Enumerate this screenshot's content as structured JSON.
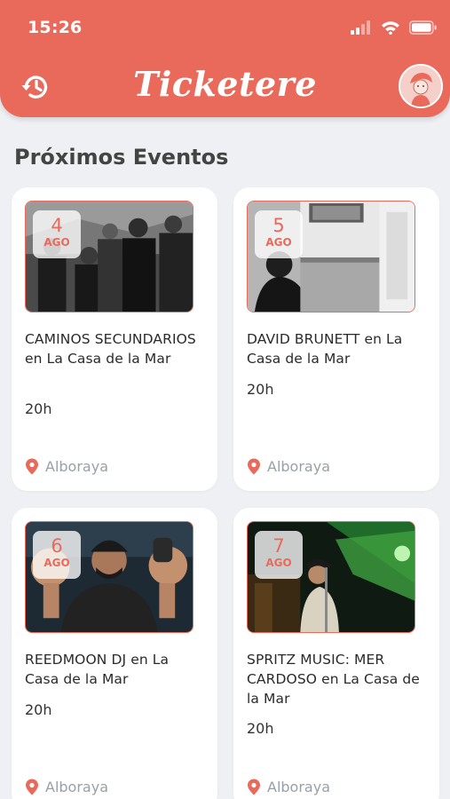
{
  "status_bar": {
    "time": "15:26"
  },
  "header": {
    "app_title": "Ticketere"
  },
  "section": {
    "title": "Próximos Eventos"
  },
  "events": [
    {
      "day": "4",
      "month": "AGO",
      "title": "CAMINOS SECUNDARIOS en La Casa de la Mar",
      "time": "20h",
      "location": "Alboraya"
    },
    {
      "day": "5",
      "month": "AGO",
      "title": "DAVID BRUNETT en La Casa de la Mar",
      "time": "20h",
      "location": "Alboraya"
    },
    {
      "day": "6",
      "month": "AGO",
      "title": "REEDMOON DJ en La Casa de la Mar",
      "time": "20h",
      "location": "Alboraya"
    },
    {
      "day": "7",
      "month": "AGO",
      "title": "SPRITZ MUSIC: MER CARDOSO en La Casa de la Mar",
      "time": "20h",
      "location": "Alboraya"
    }
  ],
  "colors": {
    "accent": "#e96a5b",
    "background": "#eef0f3",
    "muted": "#9aa0a8"
  },
  "icons": {
    "history": "history-icon",
    "location": "location-pin-icon"
  }
}
